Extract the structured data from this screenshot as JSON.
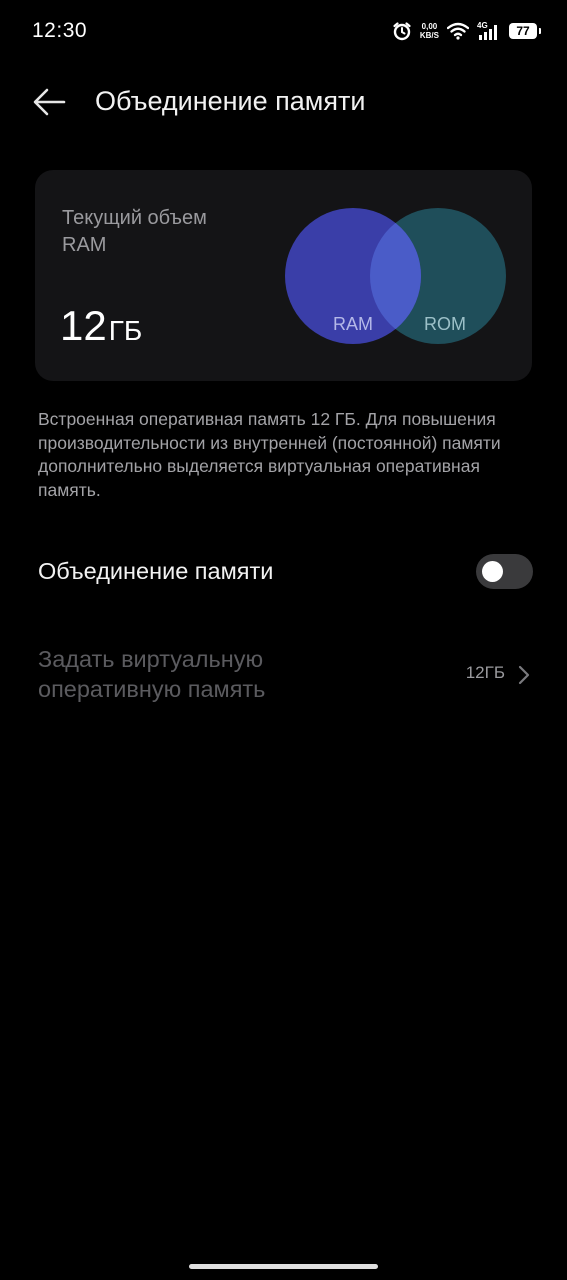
{
  "status_bar": {
    "time": "12:30",
    "net_speed_value": "0,00",
    "net_speed_unit": "KB/S",
    "network_type": "4G",
    "battery_level": "77",
    "icons": [
      "alarm-icon",
      "wifi-icon",
      "signal-icon",
      "battery-icon"
    ]
  },
  "header": {
    "title": "Объединение памяти",
    "back_icon": "arrow-left-icon"
  },
  "ram_card": {
    "label": "Текущий объем RAM",
    "value": "12",
    "unit": "ГБ",
    "venn": {
      "left_label": "RAM",
      "right_label": "ROM",
      "ram_color": "#3a3ea8",
      "rom_color": "#1f4e5a",
      "overlap_color": "#4a5cc8"
    }
  },
  "description": "Встроенная оперативная память 12 ГБ. Для повышения производительности из внутренней (постоянной) памяти дополнительно выделяется виртуальная оперативная память.",
  "memory_merge": {
    "label": "Объединение памяти",
    "enabled": false
  },
  "virtual_ram": {
    "label": "Задать виртуальную оперативную память",
    "value": "12ГБ",
    "icon": "chevron-right-icon"
  }
}
